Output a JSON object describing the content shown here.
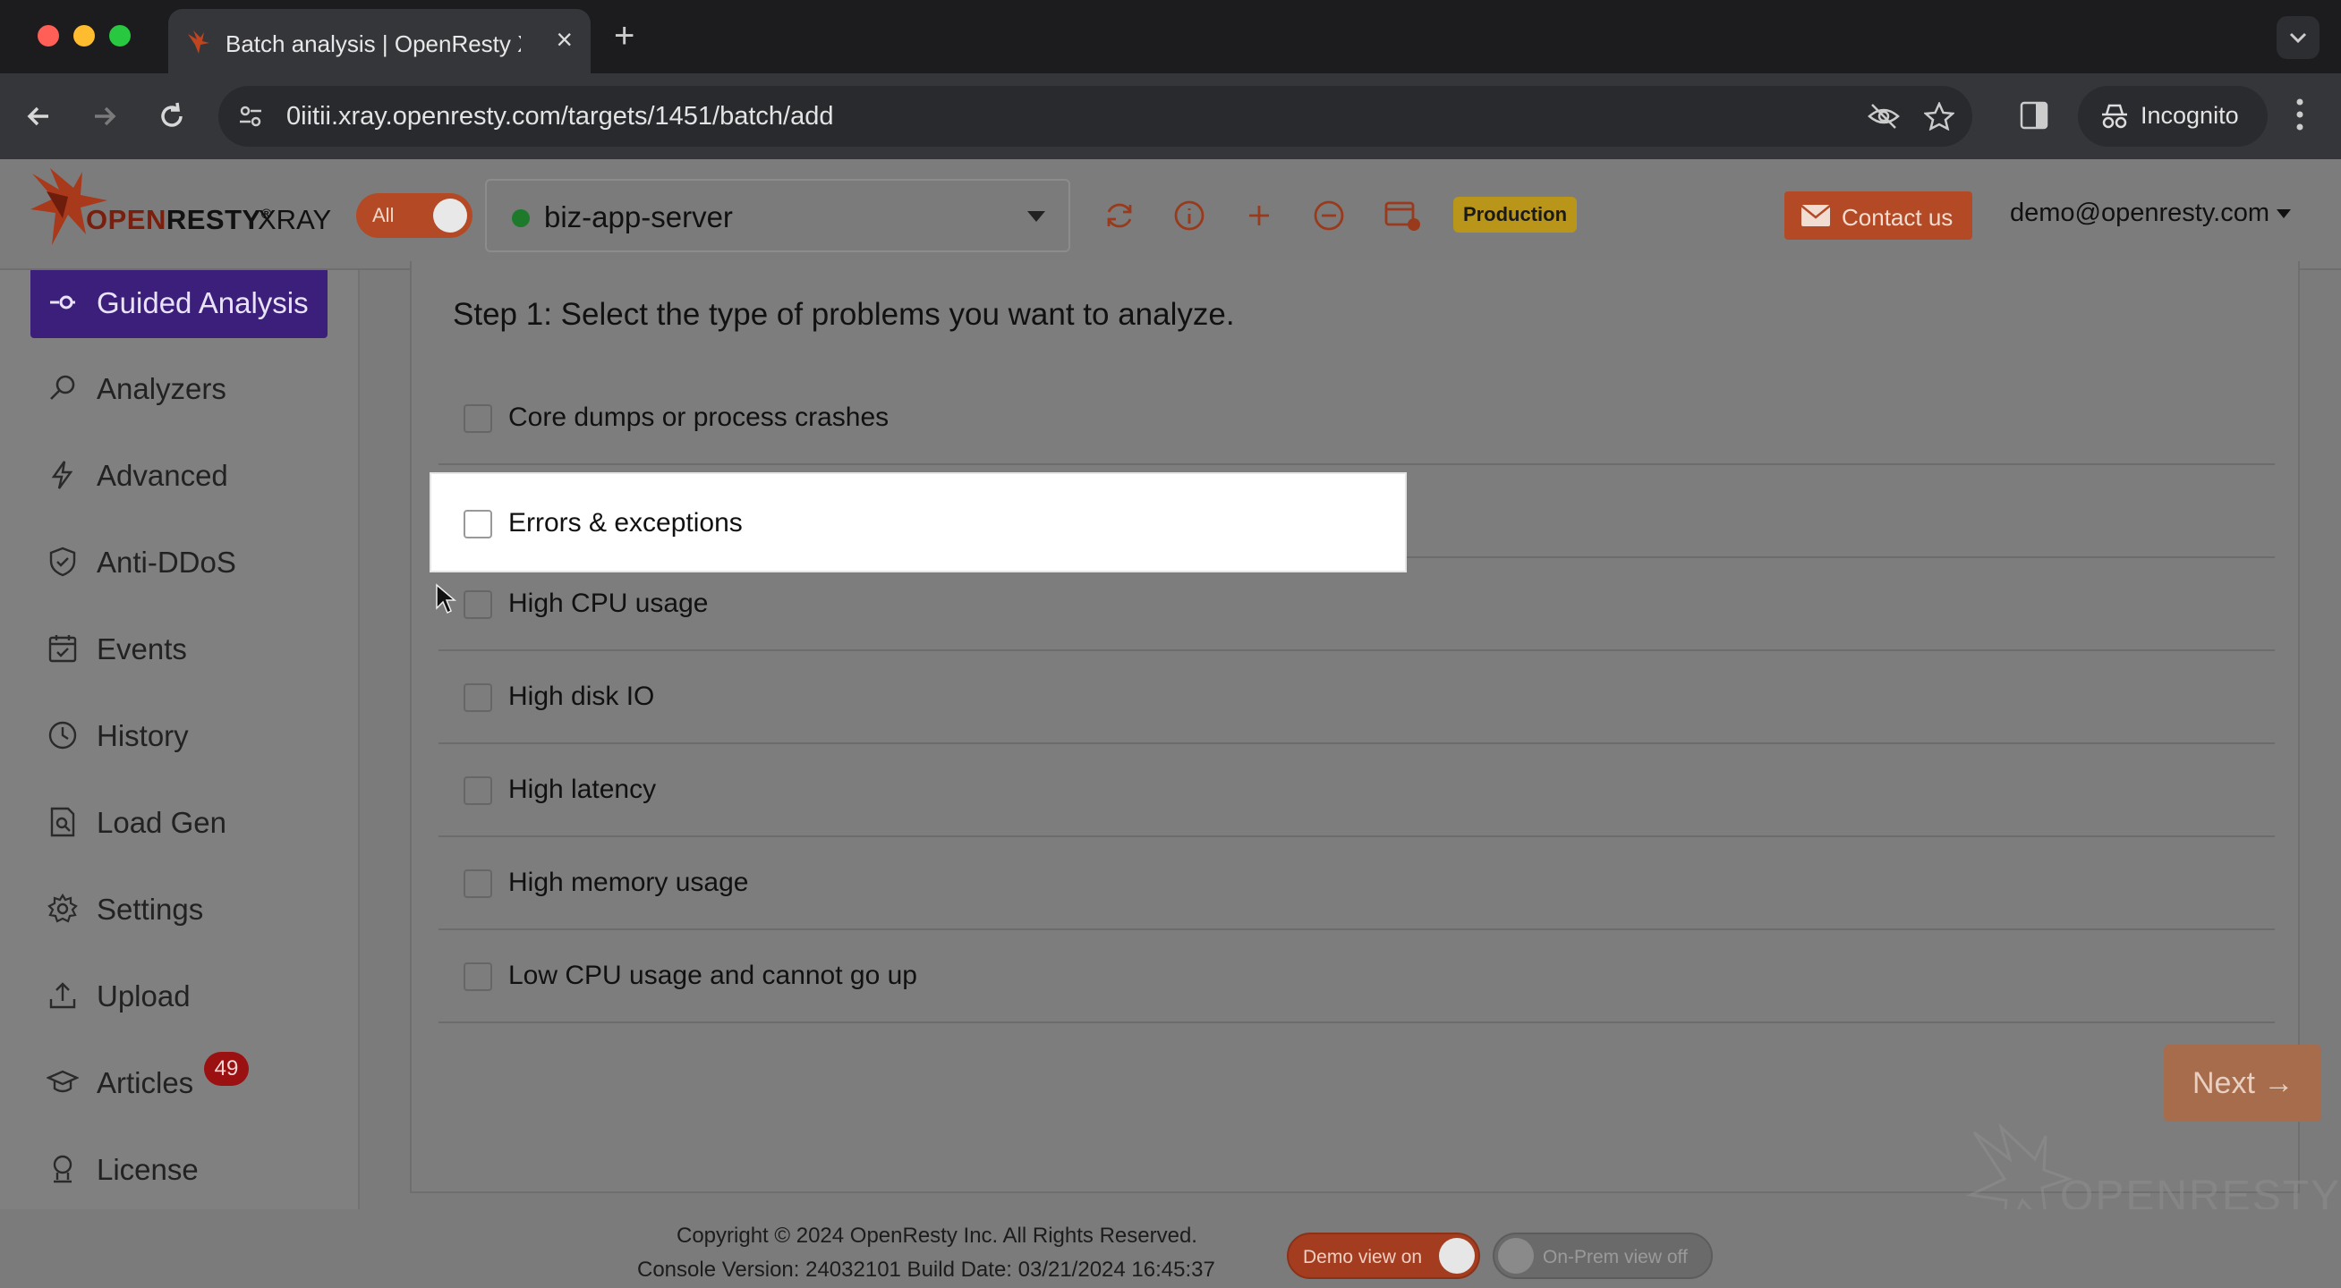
{
  "browser": {
    "tab_title": "Batch analysis | OpenResty X",
    "url": "0iitii.xray.openresty.com/targets/1451/batch/add",
    "incognito_label": "Incognito"
  },
  "header": {
    "logo_open": "OPEN",
    "logo_resty": "RESTY",
    "logo_reg": "®",
    "logo_xray": "XRAY",
    "toggle_all_label": "All",
    "target_name": "biz-app-server",
    "target_status_color": "#1d7a2b",
    "environment_badge": "Production",
    "contact_label": "Contact us",
    "user_email": "demo@openresty.com"
  },
  "sidebar": {
    "items": [
      {
        "label": "Guided Analysis",
        "icon": "guided-analysis-icon",
        "active": true
      },
      {
        "label": "Analyzers",
        "icon": "magnifier-icon"
      },
      {
        "label": "Advanced",
        "icon": "bolt-icon"
      },
      {
        "label": "Anti-DDoS",
        "icon": "shield-icon"
      },
      {
        "label": "Events",
        "icon": "calendar-icon"
      },
      {
        "label": "History",
        "icon": "clock-icon"
      },
      {
        "label": "Load Gen",
        "icon": "document-search-icon"
      },
      {
        "label": "Settings",
        "icon": "gear-icon"
      },
      {
        "label": "Upload",
        "icon": "upload-icon"
      },
      {
        "label": "Articles",
        "icon": "graduation-cap-icon",
        "badge": "49"
      },
      {
        "label": "License",
        "icon": "award-icon"
      }
    ]
  },
  "main": {
    "step_title": "Step 1: Select the type of problems you want to analyze.",
    "options": [
      {
        "label": "Core dumps or process crashes",
        "checked": false
      },
      {
        "label": "Errors & exceptions",
        "checked": false,
        "highlighted": true
      },
      {
        "label": "High CPU usage",
        "checked": false
      },
      {
        "label": "High disk IO",
        "checked": false
      },
      {
        "label": "High latency",
        "checked": false
      },
      {
        "label": "High memory usage",
        "checked": false
      },
      {
        "label": "Low CPU usage and cannot go up",
        "checked": false
      }
    ],
    "next_label": "Next →",
    "watermark_text": "OPENRESTY"
  },
  "footer": {
    "copyright": "Copyright © 2024 OpenResty Inc. All Rights Reserved.",
    "version": "Console Version: 24032101 Build Date: 03/21/2024 16:45:37",
    "demo_view_label": "Demo view on",
    "onprem_view_label": "On-Prem view off"
  },
  "colors": {
    "accent": "#b34a25",
    "active_nav": "#3c1f7a",
    "badge": "#9b1010"
  }
}
